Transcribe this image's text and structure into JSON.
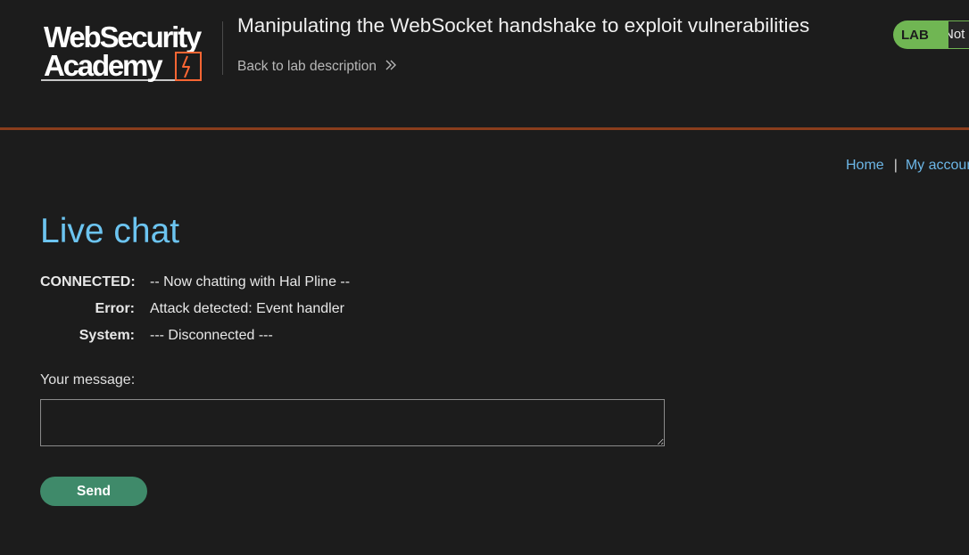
{
  "header": {
    "logo_alt": "Web Security Academy",
    "lab_title": "Manipulating the WebSocket handshake to exploit vulnerabilities",
    "back_link": "Back to lab description",
    "lab_badge": "LAB",
    "lab_status": "Not solved"
  },
  "nav": {
    "home": "Home",
    "separator": "|",
    "account": "My account"
  },
  "page": {
    "title": "Live chat"
  },
  "chat": {
    "messages": [
      {
        "who": "CONNECTED:",
        "text": "-- Now chatting with Hal Pline --"
      },
      {
        "who": "Error:",
        "text": "Attack detected: Event handler"
      },
      {
        "who": "System:",
        "text": "--- Disconnected ---"
      }
    ]
  },
  "form": {
    "message_label": "Your message:",
    "message_value": "",
    "send_label": "Send"
  },
  "colors": {
    "accent_blue": "#6cc4f0",
    "link_blue": "#6cb6e6",
    "lab_green": "#70b653",
    "button_green": "#3f8a6a",
    "header_rule": "#8a3d1c",
    "background": "#1c1c1c"
  },
  "icons": {
    "back": "double-chevron-right-icon",
    "logo_bolt": "lightning-bolt-icon"
  }
}
